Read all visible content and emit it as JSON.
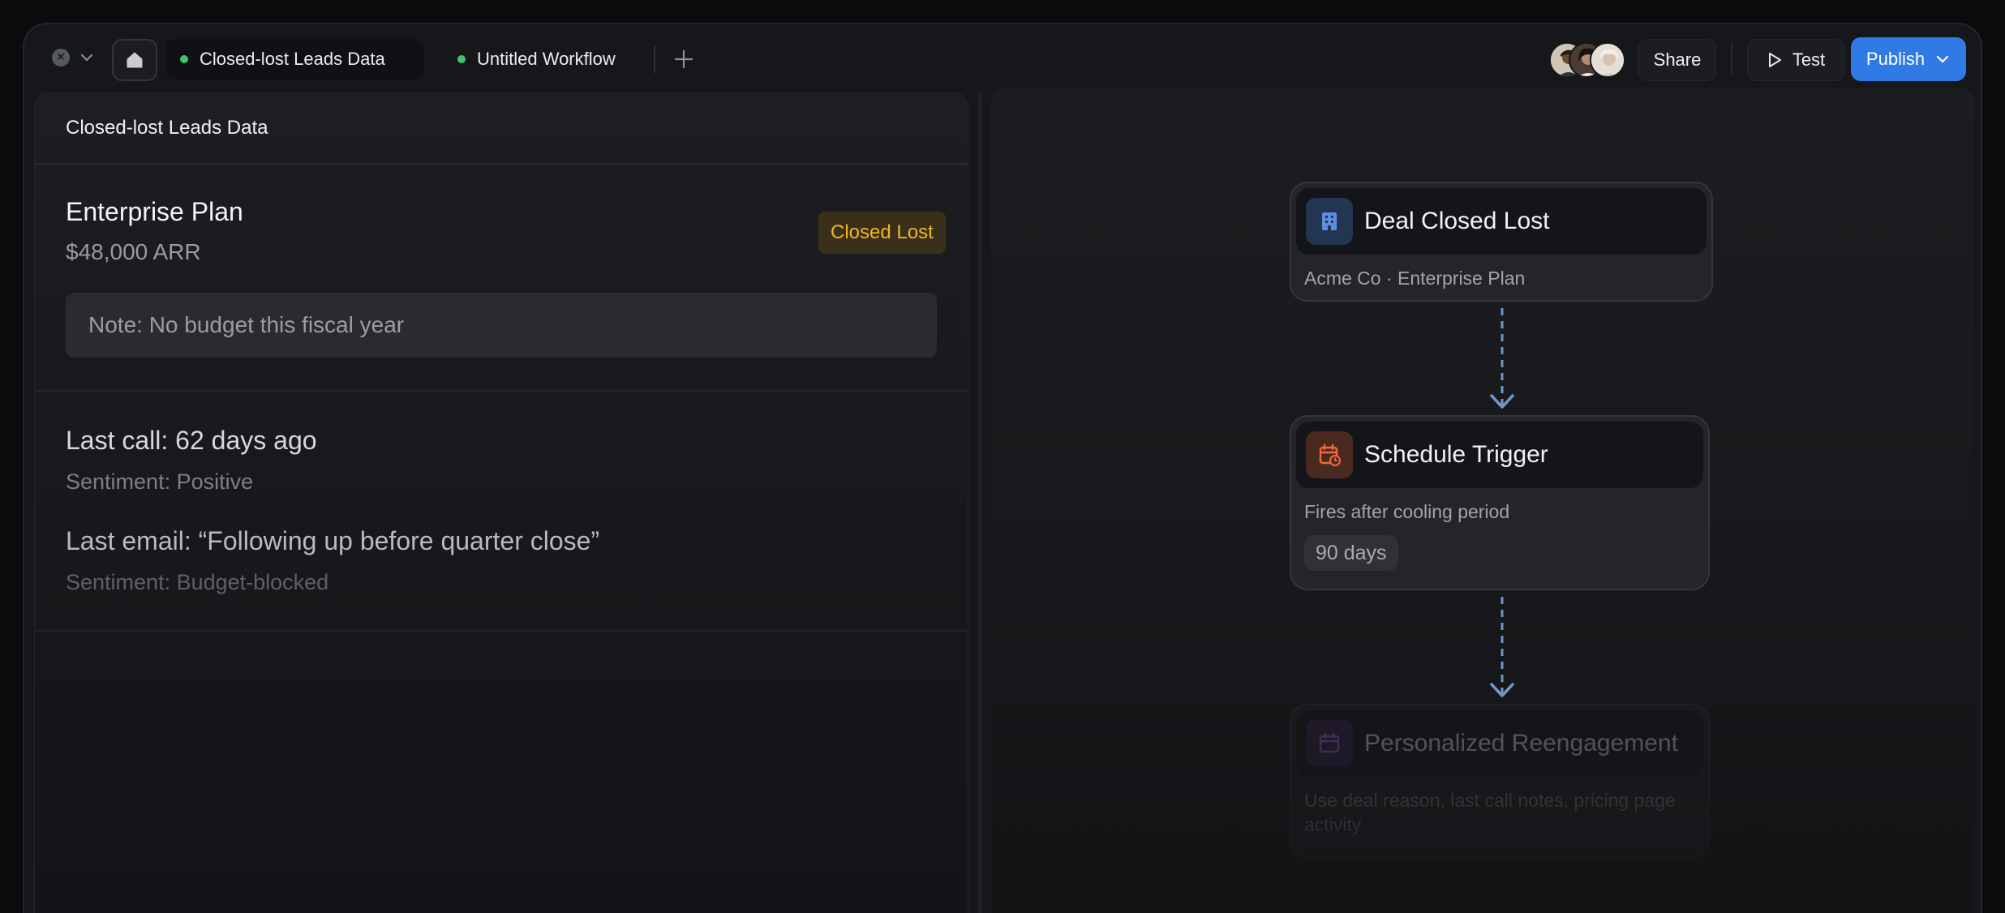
{
  "tabs": {
    "active": {
      "label": "Closed-lost Leads Data"
    },
    "inactive": {
      "label": "Untitled Workflow"
    }
  },
  "toolbar": {
    "share_label": "Share",
    "test_label": "Test",
    "publish_label": "Publish"
  },
  "left_panel": {
    "header": "Closed-lost Leads Data",
    "plan": {
      "title": "Enterprise Plan",
      "arr": "$48,000 ARR",
      "status": "Closed Lost",
      "note": "Note: No budget this fiscal year"
    },
    "activity": {
      "last_call": "Last call: 62 days ago",
      "call_sentiment": "Sentiment: Positive",
      "last_email": "Last email: “Following up before quarter close”",
      "email_sentiment": "Sentiment: Budget-blocked"
    }
  },
  "workflow": {
    "nodes": [
      {
        "title": "Deal Closed Lost",
        "subtitle": "Acme Co · Enterprise Plan",
        "icon": "building-icon"
      },
      {
        "title": "Schedule Trigger",
        "subtitle": "Fires after cooling period",
        "pill": "90 days",
        "icon": "calendar-clock-icon"
      },
      {
        "title": "Personalized Reengagement",
        "subtitle": "Use deal reason, last call notes, pricing page activity",
        "icon": "calendar-icon"
      }
    ]
  },
  "colors": {
    "accent": "#2f7ae5",
    "status_dot": "#3ec46d",
    "closed_lost_text": "#f0b42a",
    "closed_lost_bg": "#3a3019",
    "connector": "#6f96c4"
  }
}
